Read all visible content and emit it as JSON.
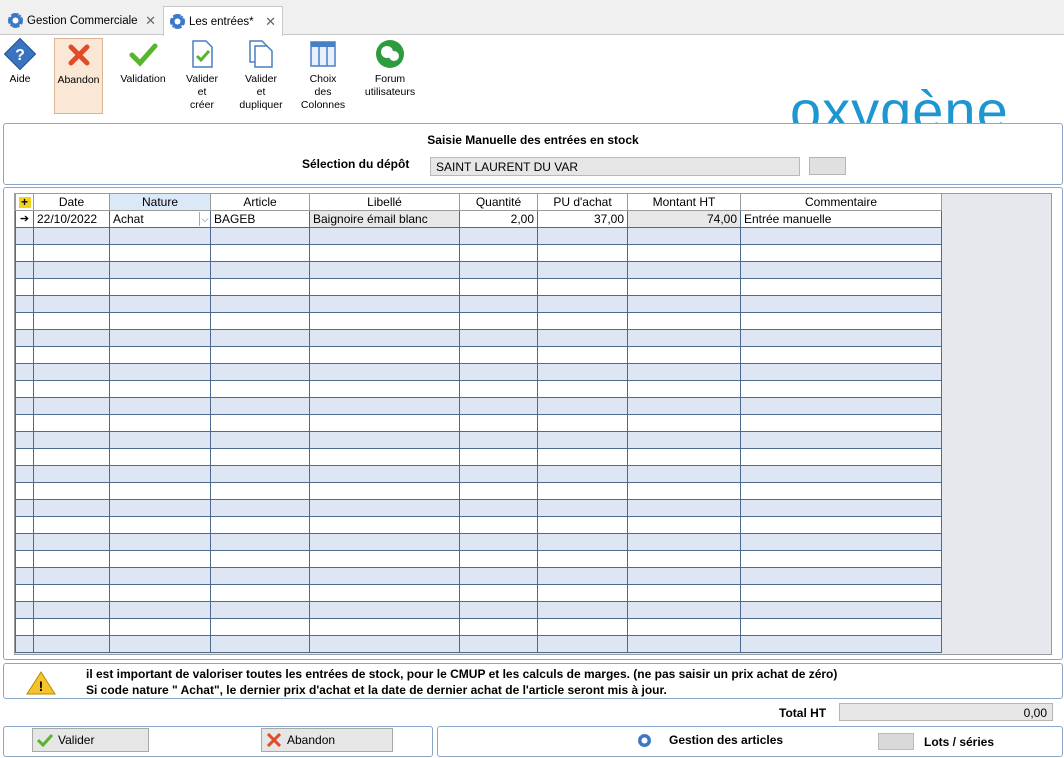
{
  "tabs": [
    {
      "label": "Gestion Commerciale"
    },
    {
      "label": "Les entrées*"
    }
  ],
  "toolbar": {
    "aide": "Aide",
    "abandon": "Abandon",
    "validation": "Validation",
    "valider_creer": [
      "Valider",
      "et",
      "créer"
    ],
    "valider_dupliquer": [
      "Valider",
      "et",
      "dupliquer"
    ],
    "choix_colonnes": [
      "Choix",
      "des",
      "Colonnes"
    ],
    "forum": [
      "Forum",
      "utilisateurs"
    ]
  },
  "logo": "oxygène",
  "form": {
    "title": "Saisie Manuelle des entrées en stock",
    "depot_label": "Sélection du dépôt",
    "depot_value": "SAINT LAURENT DU VAR"
  },
  "grid": {
    "columns": [
      "Date",
      "Nature",
      "Article",
      "Libellé",
      "Quantité",
      "PU d'achat",
      "Montant HT",
      "Commentaire"
    ],
    "row": {
      "date": "22/10/2022",
      "nature": "Achat",
      "article": "BAGEB",
      "libelle": "Baignoire émail blanc",
      "quantite": "2,00",
      "pu": "37,00",
      "montant": "74,00",
      "commentaire": "Entrée manuelle"
    }
  },
  "warning": {
    "line1": "il est important de valoriser toutes les entrées de stock, pour le CMUP et les calculs de marges. (ne pas saisir un prix achat de zéro)",
    "line2": "Si code nature \" Achat\", le dernier prix d'achat et la date de dernier achat de l'article seront mis à jour."
  },
  "total": {
    "label": "Total HT",
    "value": "0,00"
  },
  "bottom": {
    "valider": "Valider",
    "abandon": "Abandon",
    "gestion": "Gestion des articles",
    "lots": "Lots / séries"
  },
  "colors": {
    "accent": "#1e96d2",
    "grid_alt": "#dde6f2"
  }
}
